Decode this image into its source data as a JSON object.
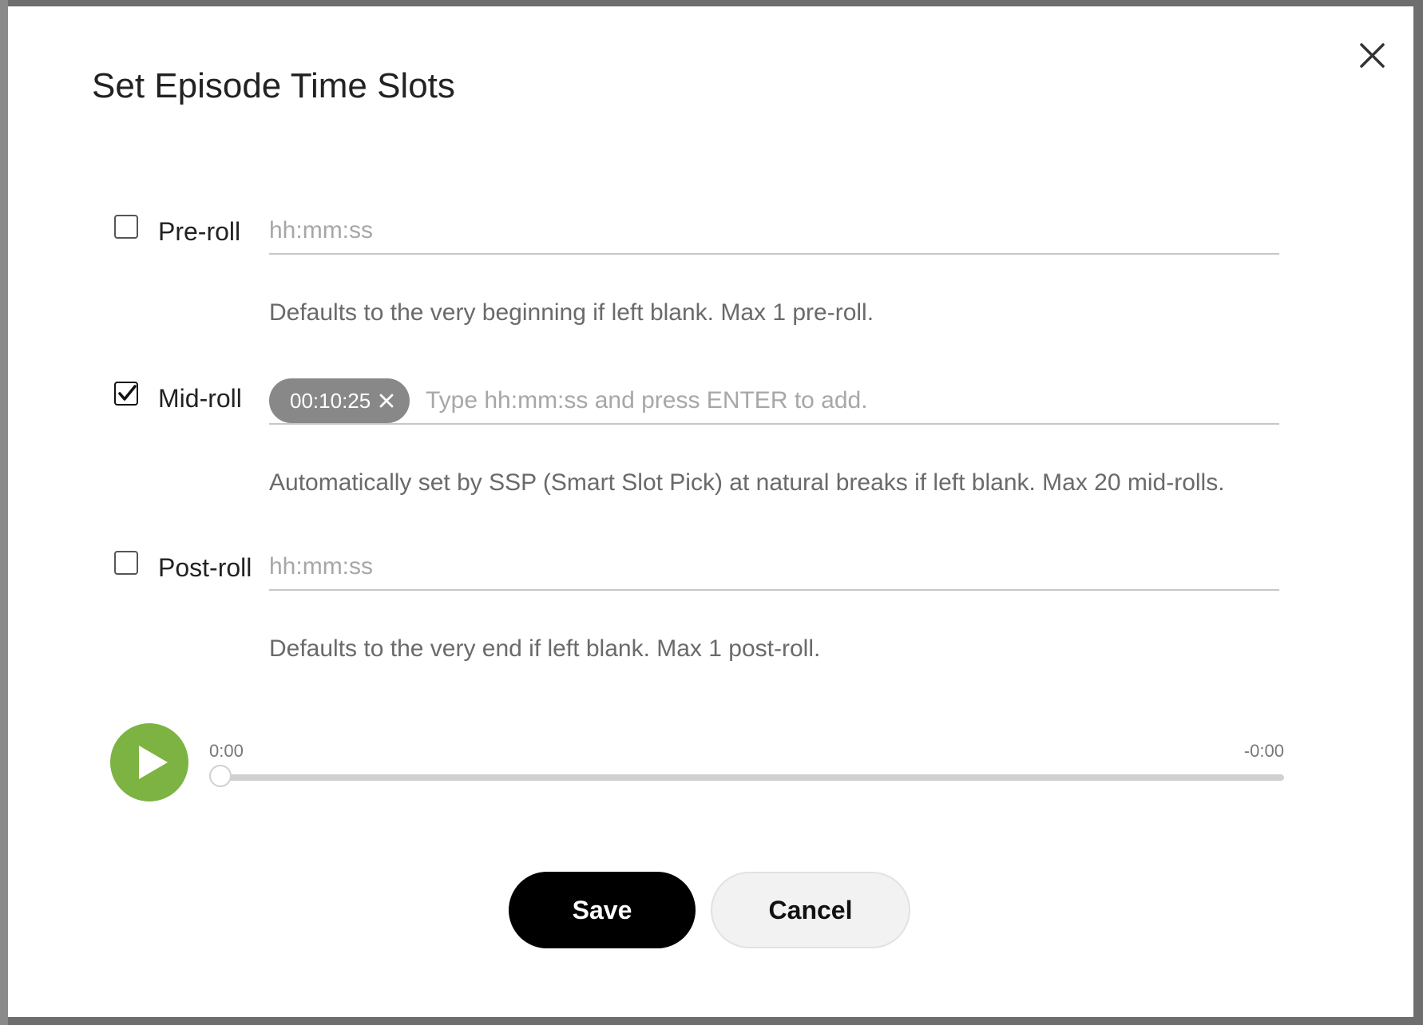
{
  "dialog": {
    "title": "Set Episode Time Slots"
  },
  "slots": {
    "preroll": {
      "label": "Pre-roll",
      "checked": false,
      "placeholder": "hh:mm:ss",
      "value": "",
      "helper": "Defaults to the very beginning if left blank. Max 1 pre-roll."
    },
    "midroll": {
      "label": "Mid-roll",
      "checked": true,
      "chips": [
        "00:10:25"
      ],
      "placeholder": "Type hh:mm:ss and press ENTER to add.",
      "value": "",
      "helper": "Automatically set by SSP (Smart Slot Pick) at natural breaks if left blank. Max 20 mid-rolls."
    },
    "postroll": {
      "label": "Post-roll",
      "checked": false,
      "placeholder": "hh:mm:ss",
      "value": "",
      "helper": "Defaults to the very end if left blank. Max 1 post-roll."
    }
  },
  "player": {
    "current_time": "0:00",
    "remaining_time": "-0:00",
    "progress": 0.0,
    "accent_color": "#7cb342"
  },
  "actions": {
    "save_label": "Save",
    "cancel_label": "Cancel"
  },
  "icons": {
    "close": "close-icon",
    "checkmark": "checkmark-icon",
    "chip_remove": "chip-remove-icon",
    "play": "play-icon"
  }
}
